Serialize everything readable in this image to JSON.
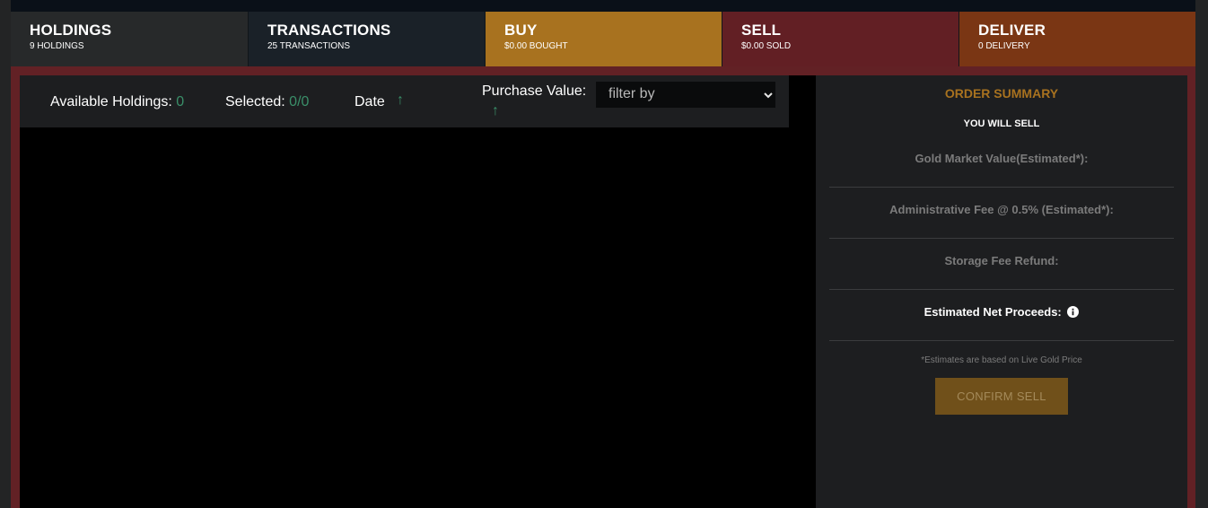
{
  "tabs": [
    {
      "title": "HOLDINGS",
      "sub": "9 HOLDINGS"
    },
    {
      "title": "TRANSACTIONS",
      "sub": "25 TRANSACTIONS"
    },
    {
      "title": "BUY",
      "sub": "$0.00 BOUGHT"
    },
    {
      "title": "SELL",
      "sub": "$0.00 SOLD"
    },
    {
      "title": "DELIVER",
      "sub": "0 DELIVERY"
    }
  ],
  "filters": {
    "available_label": "Available Holdings:",
    "available_value": "0",
    "selected_label": "Selected:",
    "selected_value": "0/0",
    "date_label": "Date",
    "purchase_label": "Purchase Value:",
    "sort_arrow": "↑",
    "filter_placeholder": "filter by"
  },
  "summary": {
    "title": "ORDER SUMMARY",
    "subtitle": "YOU WILL SELL",
    "gold_market_value": "Gold Market Value(Estimated*):",
    "admin_fee": "Administrative Fee @ 0.5% (Estimated*):",
    "storage_refund": "Storage Fee Refund:",
    "net_proceeds": "Estimated Net Proceeds:",
    "note": "*Estimates are based on Live Gold Price",
    "confirm": "CONFIRM SELL"
  },
  "icons": {
    "sort": "arrow-up-icon",
    "select": "chevron-down-icon",
    "info": "info-icon"
  },
  "colors": {
    "accent_gold": "#a8721f",
    "sell_red": "#621f24",
    "deliver_orange": "#7a3614",
    "positive_green": "#3a8f69"
  }
}
